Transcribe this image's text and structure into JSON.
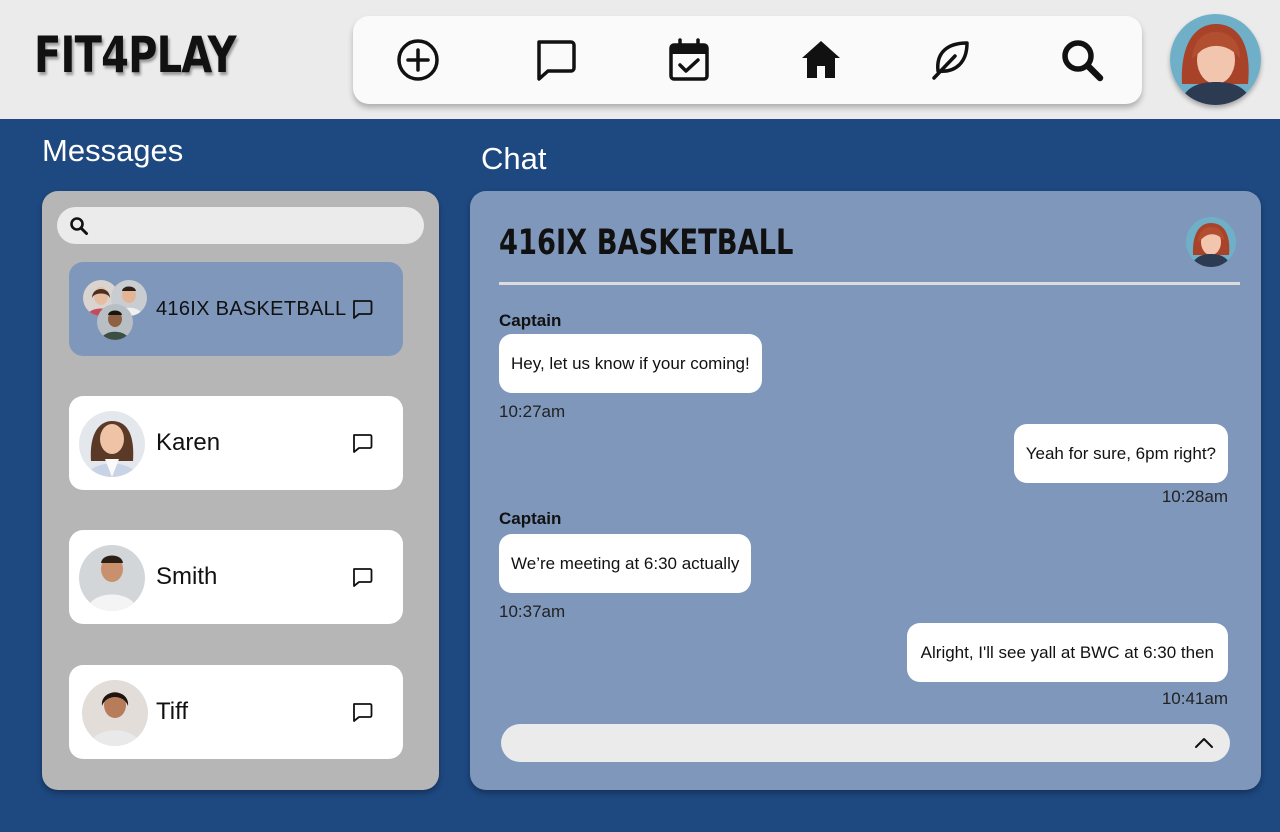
{
  "app": {
    "logo": "FIT4PLAY"
  },
  "nav": {
    "items": [
      {
        "name": "add",
        "icon": "plus-circle-icon"
      },
      {
        "name": "messages",
        "icon": "chat-bubble-icon"
      },
      {
        "name": "calendar",
        "icon": "calendar-check-icon"
      },
      {
        "name": "home",
        "icon": "home-icon"
      },
      {
        "name": "wellness",
        "icon": "leaf-icon"
      },
      {
        "name": "search",
        "icon": "search-icon"
      }
    ]
  },
  "messages": {
    "title": "Messages",
    "search": {
      "placeholder": "",
      "value": ""
    },
    "contacts": [
      {
        "name": "416IX BASKETBALL",
        "active": true
      },
      {
        "name": "Karen",
        "active": false
      },
      {
        "name": "Smith",
        "active": false
      },
      {
        "name": "Tiff",
        "active": false
      }
    ]
  },
  "chat": {
    "title": "Chat",
    "conversation_title": "416IX BASKETBALL",
    "messages": [
      {
        "sender": "Captain",
        "text": "Hey, let us know if your coming!",
        "time": "10:27am",
        "direction": "in"
      },
      {
        "sender": "",
        "text": "Yeah for sure, 6pm right?",
        "time": "10:28am",
        "direction": "out"
      },
      {
        "sender": "Captain",
        "text": "We’re meeting at 6:30 actually",
        "time": "10:37am",
        "direction": "in"
      },
      {
        "sender": "",
        "text": "Alright, I'll see yall at BWC at 6:30 then",
        "time": "10:41am",
        "direction": "out"
      }
    ],
    "compose": {
      "placeholder": "",
      "value": ""
    }
  },
  "colors": {
    "background": "#1e4880",
    "topbar": "#ebebeb",
    "panel_grey": "#b6b6b6",
    "chat_panel": "#7e97bb",
    "active_contact": "#7e97bb"
  }
}
